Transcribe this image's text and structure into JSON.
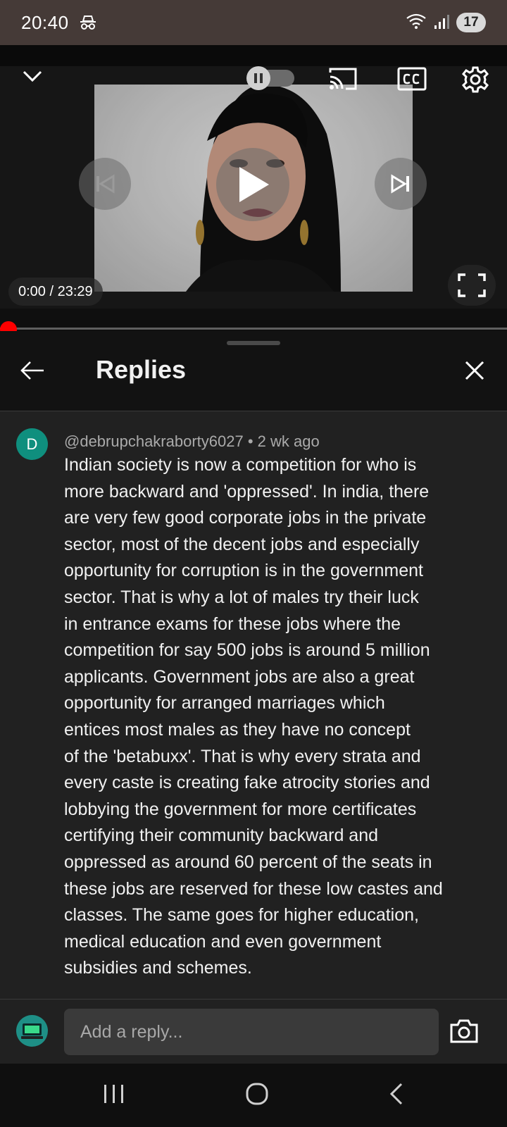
{
  "status_bar": {
    "time": "20:40",
    "battery": "17",
    "icons": [
      "incognito-icon",
      "wifi-icon",
      "signal-icon"
    ]
  },
  "player": {
    "time_display": "0:00 / 23:29",
    "progress_fraction": 0.0,
    "autoplay": "paused",
    "icons": [
      "collapse-chevron-icon",
      "autoplay-toggle-icon",
      "cast-icon",
      "captions-icon",
      "settings-gear-icon",
      "previous-icon",
      "play-icon",
      "next-icon",
      "fullscreen-icon"
    ]
  },
  "sheet": {
    "title": "Replies"
  },
  "comment": {
    "avatar_letter": "D",
    "avatar_color": "#0f8f7e",
    "author": "@debrupchakraborty6027",
    "separator": "•",
    "age": "2 wk ago",
    "lines": [
      "Indian society is now a competition for who is",
      "more backward and 'oppressed'. In india, there",
      "are very few good corporate jobs in the private",
      "sector, most of the decent jobs and especially",
      "opportunity for corruption is in the government",
      "sector. That is why a lot of males try their luck",
      "in entrance exams for these jobs where the",
      "competition for say 500 jobs is around 5 million",
      "applicants. Government jobs are also a great",
      "opportunity for arranged marriages which",
      "entices most males as they have no concept",
      "of the 'betabuxx'. That is why every strata and",
      "every caste is creating fake atrocity stories and",
      "lobbying the government for more certificates",
      "certifying their community backward and",
      "oppressed as around 60 percent of the seats in",
      "these jobs are reserved for these low castes and",
      "classes. The same goes for higher education,",
      "medical education and even government",
      "subsidies and schemes."
    ]
  },
  "reply_bar": {
    "placeholder": "Add a reply..."
  },
  "colors": {
    "accent": "#ff0000",
    "sheet_bg": "#212121",
    "status_bar_bg": "#453a37"
  }
}
